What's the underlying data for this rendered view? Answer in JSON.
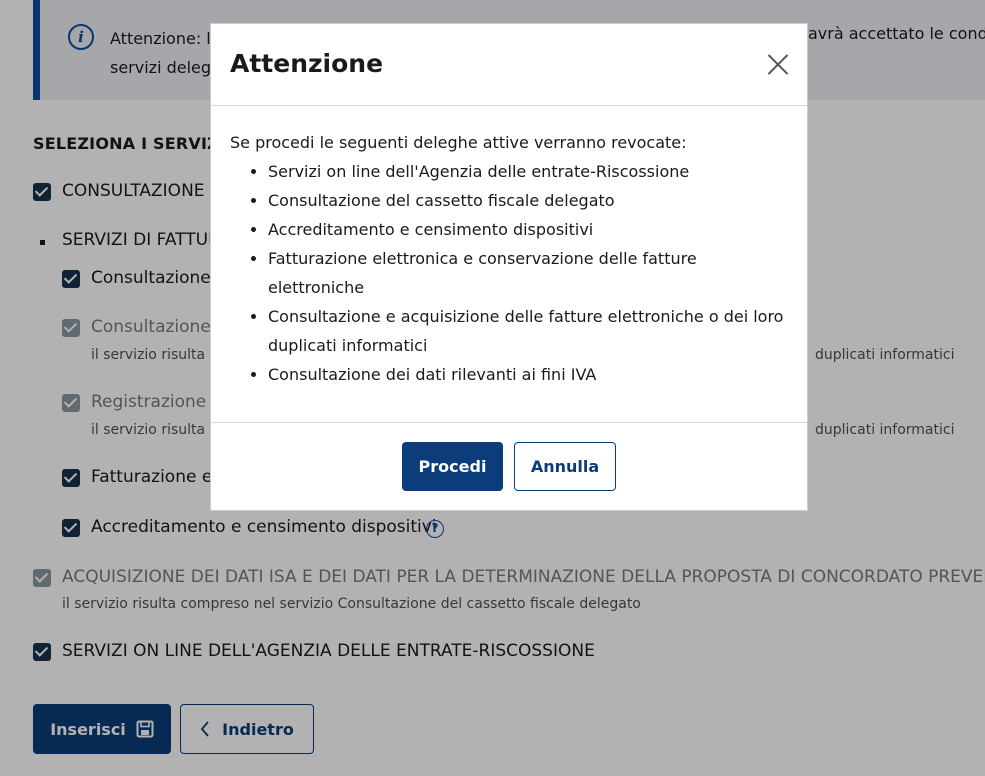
{
  "callout": {
    "icon": "info-icon",
    "text_start": "Attenzione: l",
    "text_line2": "servizi deleg",
    "text_right": "avrà accettato le condiz"
  },
  "section_title": "SELEZIONA I SERVIZI",
  "services": {
    "consultazione_d": "CONSULTAZIONE D",
    "servizi_fattur": "SERVIZI DI FATTUR",
    "sub1": "Consultazione",
    "sub2": "Consultazione",
    "sub2_note": "il servizio risulta",
    "sub2_note_right": "duplicati informatici",
    "sub3": "Registrazione",
    "sub3_note": "il servizio risulta",
    "sub3_note_right": "duplicati informatici",
    "sub4": "Fatturazione el",
    "sub5": "Accreditamento e censimento dispositivi",
    "help_symbol": "?",
    "isa": "ACQUISIZIONE DEI DATI ISA E DEI DATI PER LA DETERMINAZIONE DELLA PROPOSTA DI CONCORDATO PREVENTIV",
    "isa_note": "il servizio risulta compreso nel servizio Consultazione del cassetto fiscale delegato",
    "riscossione": "SERVIZI ON LINE DELL'AGENZIA DELLE ENTRATE-RISCOSSIONE"
  },
  "buttons": {
    "insert": "Inserisci",
    "back": "Indietro"
  },
  "modal": {
    "title": "Attenzione",
    "intro": "Se procedi le seguenti deleghe attive verranno revocate:",
    "items": [
      "Servizi on line dell'Agenzia delle entrate-Riscossione",
      "Consultazione del cassetto fiscale delegato",
      "Accreditamento e censimento dispositivi",
      "Fatturazione elettronica e conservazione delle fatture elettroniche",
      "Consultazione e acquisizione delle fatture elettroniche o dei loro duplicati informatici",
      "Consultazione dei dati rilevanti ai fini IVA"
    ],
    "confirm": "Procedi",
    "cancel": "Annulla"
  },
  "colors": {
    "primary": "#0b3d7a",
    "accent": "#0b4ea2",
    "checkbox": "#17324d"
  }
}
